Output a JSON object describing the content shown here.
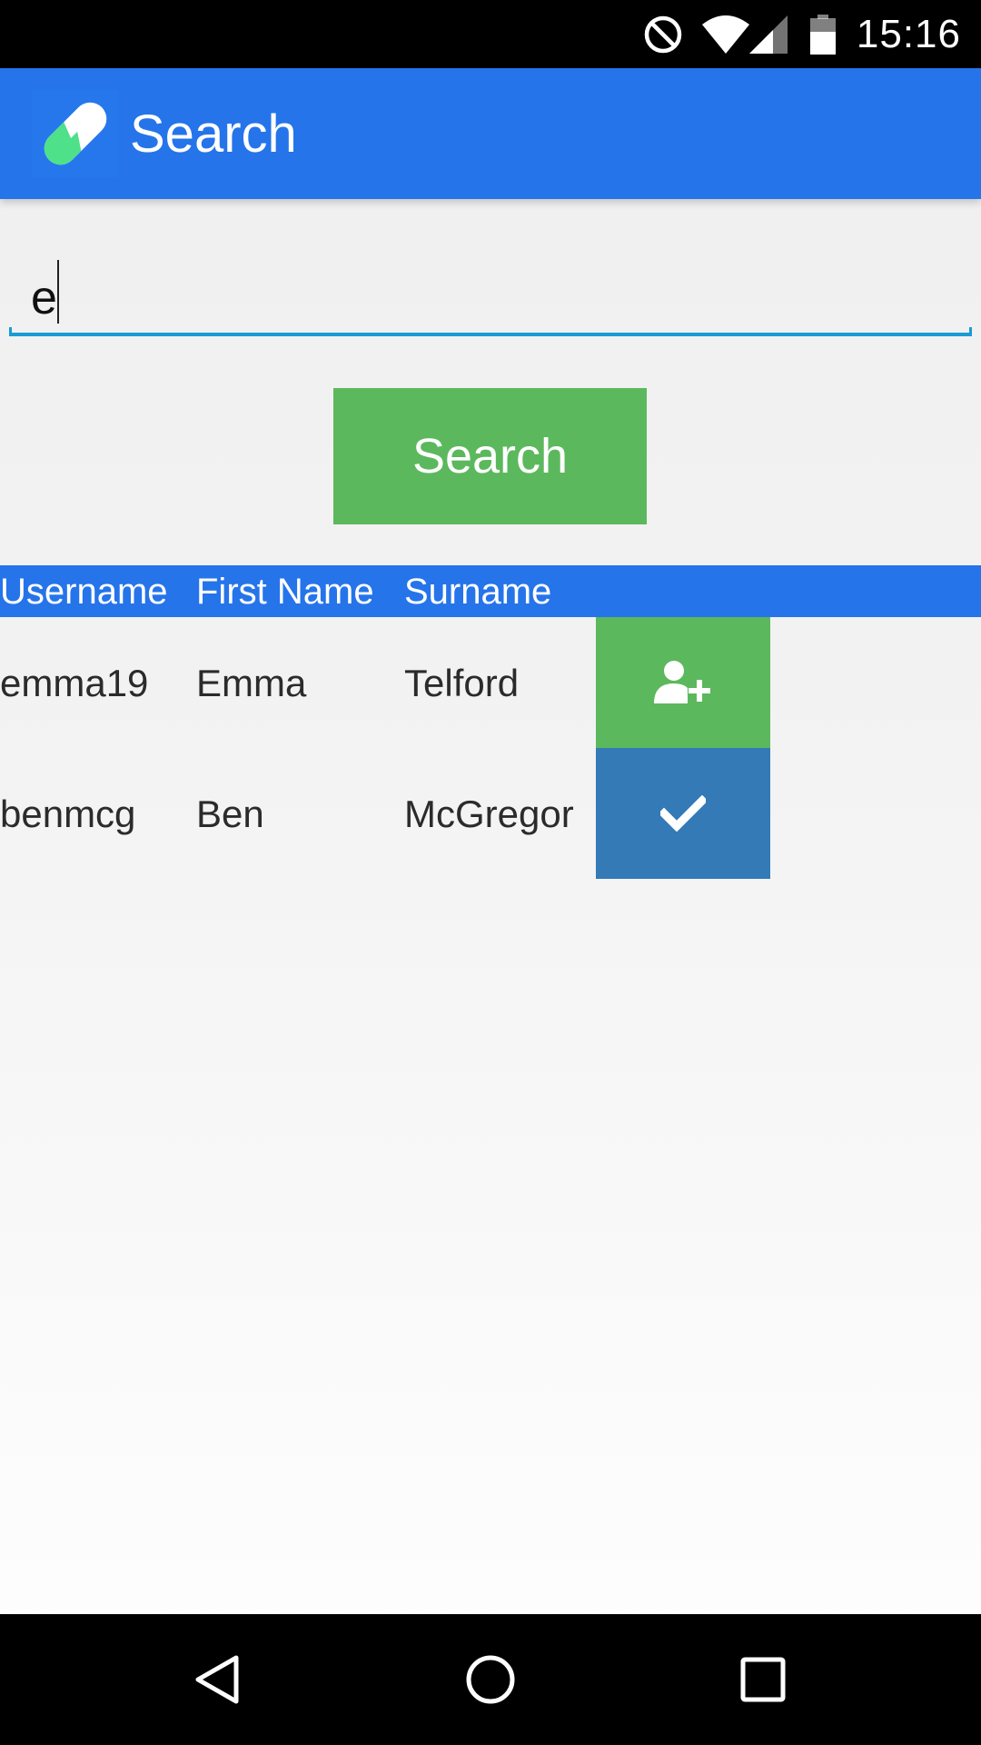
{
  "status_bar": {
    "time": "15:16",
    "icons": [
      "do-not-disturb-icon",
      "wifi-icon",
      "cell-signal-icon",
      "battery-icon"
    ]
  },
  "app_bar": {
    "title": "Search",
    "logo_icon": "pill-logo-icon"
  },
  "search": {
    "value": "e",
    "button_label": "Search"
  },
  "table": {
    "headers": [
      "Username",
      "First Name",
      "Surname"
    ],
    "rows": [
      {
        "username": "emma19",
        "first_name": "Emma",
        "surname": "Telford",
        "action_icon": "add-user-icon"
      },
      {
        "username": "benmcg",
        "first_name": "Ben",
        "surname": "McGregor",
        "action_icon": "check-icon"
      }
    ]
  },
  "nav_bar": {
    "icons": [
      "back-icon",
      "home-icon",
      "recents-icon"
    ]
  },
  "colors": {
    "primary": "#2574ea",
    "success": "#5cb85c",
    "info": "#337ab7",
    "accent_line": "#1a9ad6"
  }
}
